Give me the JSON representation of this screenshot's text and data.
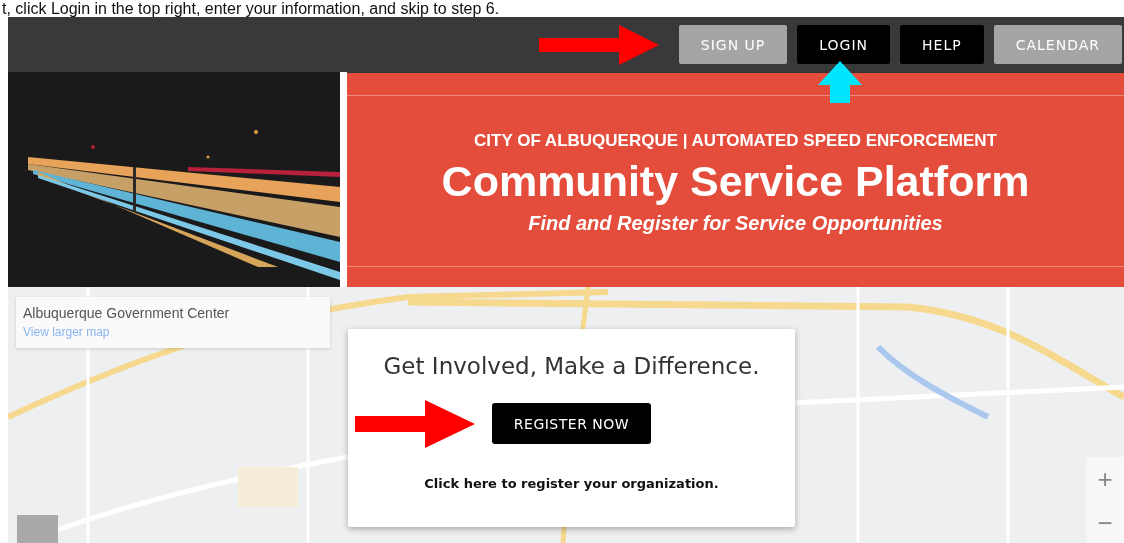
{
  "instruction": "t, click Login in the top right, enter your information, and skip to step 6.",
  "nav": {
    "buttons": [
      {
        "label": "SIGN UP",
        "kind": "light"
      },
      {
        "label": "LOGIN",
        "kind": "dark"
      },
      {
        "label": "HELP",
        "kind": "dark"
      },
      {
        "label": "CALENDAR",
        "kind": "light"
      }
    ]
  },
  "banner": {
    "kicker": "CITY OF ALBUQUERQUE | AUTOMATED SPEED ENFORCEMENT",
    "title": "Community Service Platform",
    "subtitle": "Find and Register for Service Opportunities"
  },
  "map": {
    "place_name": "Albuquerque Government Center",
    "link": "View larger map",
    "zoom_in": "+",
    "zoom_out": "−"
  },
  "card": {
    "heading": "Get Involved, Make a Difference.",
    "button": "REGISTER NOW",
    "note": "Click here to register your organization."
  }
}
